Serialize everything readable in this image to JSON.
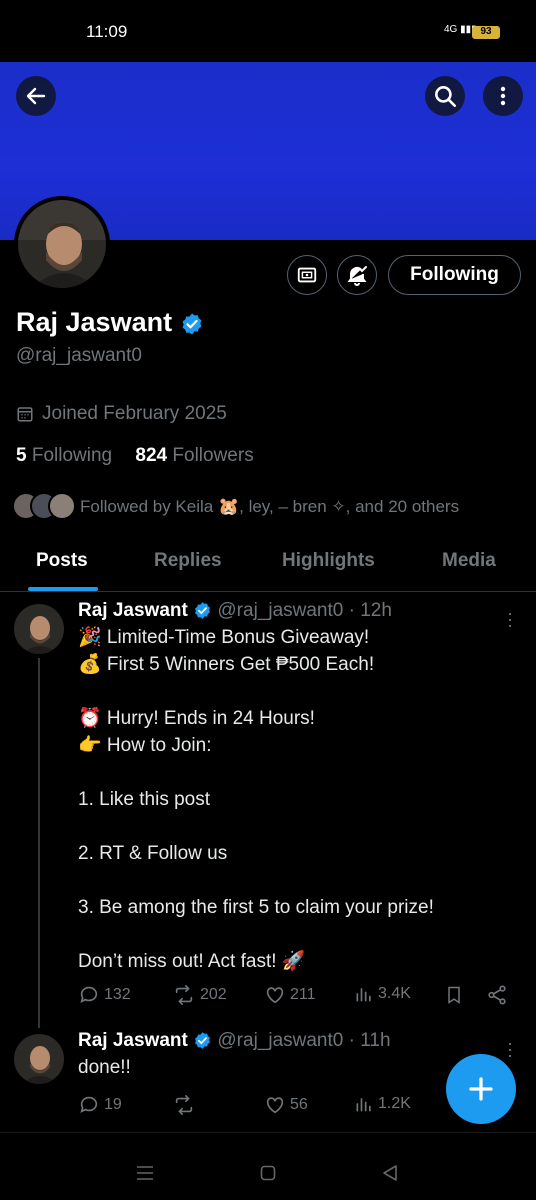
{
  "status": {
    "time": "11:09",
    "signal": "4G",
    "battery": "93"
  },
  "profile": {
    "name": "Raj Jaswant",
    "handle": "@raj_jaswant0",
    "joined": "Joined February 2025",
    "following_count": "5",
    "following_label": "Following",
    "followers_count": "824",
    "followers_label": "Followers",
    "followed_by": "Followed by Keila 🐹, ley, – bren ✧, and 20 others",
    "follow_button": "Following"
  },
  "tabs": [
    "Posts",
    "Replies",
    "Highlights",
    "Media"
  ],
  "posts": [
    {
      "name": "Raj Jaswant",
      "meta": "@raj_jaswant0 · 12h",
      "lines": [
        "🎉 Limited-Time Bonus Giveaway!",
        "💰 First 5 Winners Get ₱500 Each!",
        "",
        "⏰ Hurry! Ends in 24 Hours!",
        "👉 How to Join:",
        "",
        "1. Like this post",
        "",
        "2. RT & Follow us",
        "",
        "3. Be among the first 5 to claim your prize!",
        "",
        "Don’t miss out! Act fast! 🚀"
      ],
      "replies": "132",
      "reposts": "202",
      "likes": "211",
      "views": "3.4K"
    },
    {
      "name": "Raj Jaswant",
      "meta": "@raj_jaswant0 · 11h",
      "lines": [
        "done!!"
      ],
      "replies": "19",
      "reposts": "",
      "likes": "56",
      "views": "1.2K"
    }
  ],
  "colors": {
    "accent": "#1d9bf0",
    "banner": "#1d2fd6",
    "muted": "#71767b",
    "background": "#000000"
  }
}
